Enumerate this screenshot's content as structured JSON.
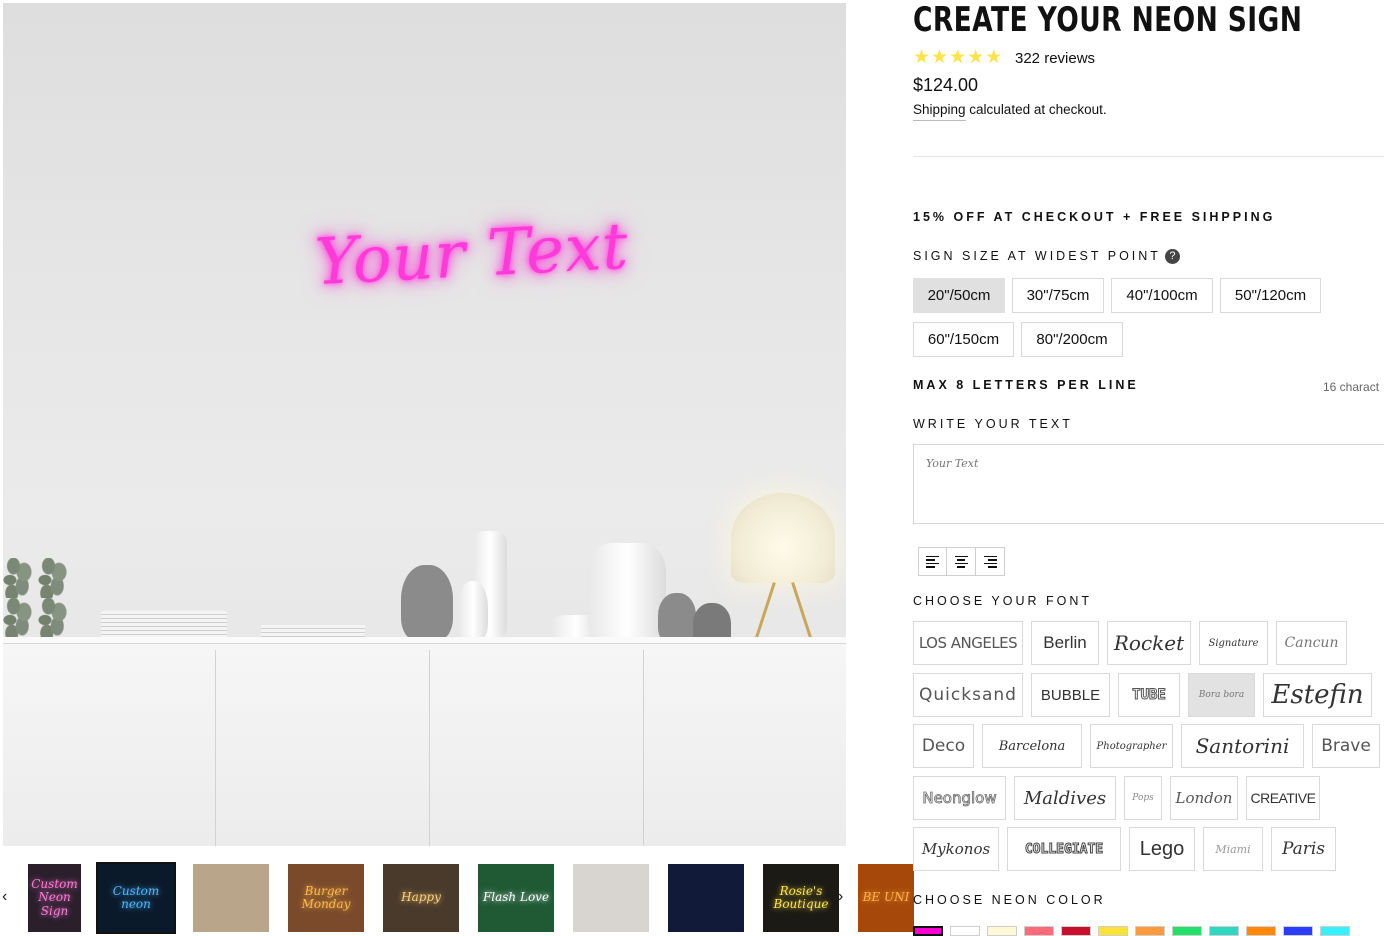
{
  "product": {
    "title": "CREATE YOUR NEON SIGN",
    "rating_stars": 5,
    "reviews": "322 reviews",
    "price": "$124.00",
    "shipping_link": "Shipping",
    "shipping_text": " calculated at checkout."
  },
  "preview": {
    "neon_text": "Your Text",
    "neon_color": "#ff3ad9"
  },
  "promo": "15% OFF AT CHECKOUT + FREE SIHPPING",
  "size": {
    "label": "SIGN SIZE AT WIDEST POINT",
    "help": "?",
    "options": [
      "20\"/50cm",
      "30\"/75cm",
      "40\"/100cm",
      "50\"/120cm",
      "60\"/150cm",
      "80\"/200cm"
    ],
    "selected": "20\"/50cm"
  },
  "text": {
    "max_label": "MAX 8 LETTERS PER LINE",
    "char_count": "16 charact",
    "write_label": "WRITE YOUR TEXT",
    "placeholder": "Your Text"
  },
  "fonts": {
    "label": "CHOOSE YOUR FONT",
    "options": [
      "LOS ANGELES",
      "Berlin",
      "Rocket",
      "Signature",
      "Cancun",
      "Quicksand",
      "BUBBLE",
      "TUBE",
      "Bora bora",
      "Estefin",
      "Deco",
      "Barcelona",
      "Photographer",
      "Santorini",
      "Brave",
      "Neonglow",
      "Maldives",
      "Pops",
      "London",
      "CREATIVE",
      "Mykonos",
      "COLLEGIATE",
      "Lego",
      "Miami",
      "Paris"
    ],
    "selected": "Bora bora"
  },
  "colors": {
    "label": "CHOOSE NEON COLOR",
    "swatches": [
      "#ff00d4",
      "#ffffff",
      "#fff8d6",
      "#ff6b7a",
      "#c8102e",
      "#ffe13a",
      "#ff9a3c",
      "#22e06a",
      "#2ed8c0",
      "#ff8a00",
      "#2a3cff",
      "#35f0ff",
      "#6a00ff"
    ],
    "selected": "#ff00d4"
  },
  "thumbnails": {
    "prev": "‹",
    "next": "›",
    "items": [
      {
        "caption": "Custom Neon Sign",
        "bg": "#2a1f2b",
        "fg": "#ff7ad8"
      },
      {
        "caption": "Custom neon",
        "bg": "#0b1a2b",
        "fg": "#4fb7ff"
      },
      {
        "caption": "",
        "bg": "#b9a58a",
        "fg": "#fff3c4"
      },
      {
        "caption": "Burger Monday",
        "bg": "#7a4a2b",
        "fg": "#ffb84a"
      },
      {
        "caption": "Happy",
        "bg": "#4a3a2c",
        "fg": "#ffd27a"
      },
      {
        "caption": "Flash Love",
        "bg": "#1f5a35",
        "fg": "#ffffff"
      },
      {
        "caption": "",
        "bg": "#d8d4cf",
        "fg": "#ff8fd0"
      },
      {
        "caption": "",
        "bg": "#121a3a",
        "fg": "#3a6bff"
      },
      {
        "caption": "Rosie's Boutique",
        "bg": "#1b1a14",
        "fg": "#ffe44a"
      },
      {
        "caption": "BE UNI",
        "bg": "#a5480a",
        "fg": "#ffb14a"
      }
    ]
  }
}
